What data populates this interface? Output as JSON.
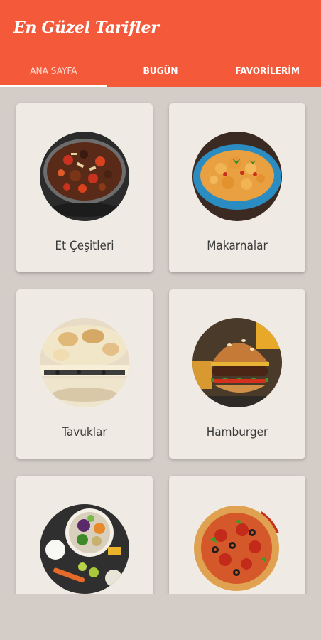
{
  "app": {
    "title": "En Güzel Tarifler"
  },
  "tabs": [
    {
      "label": "ANA SAYFA",
      "active": true
    },
    {
      "label": "BUGÜN",
      "active": false
    },
    {
      "label": "FAVORİLERİM",
      "active": false
    }
  ],
  "categories": [
    {
      "label": "Et Çeşitleri",
      "icon": "meat-stew-image"
    },
    {
      "label": "Makarnalar",
      "icon": "pasta-image"
    },
    {
      "label": "Tavuklar",
      "icon": "chicken-gratin-image"
    },
    {
      "label": "Hamburger",
      "icon": "hamburger-image"
    },
    {
      "label": "",
      "icon": "salad-bowl-image"
    },
    {
      "label": "",
      "icon": "pizza-image"
    }
  ],
  "colors": {
    "appbar": "#f4593a",
    "background": "#d3ccc7",
    "card": "#efeae3"
  }
}
